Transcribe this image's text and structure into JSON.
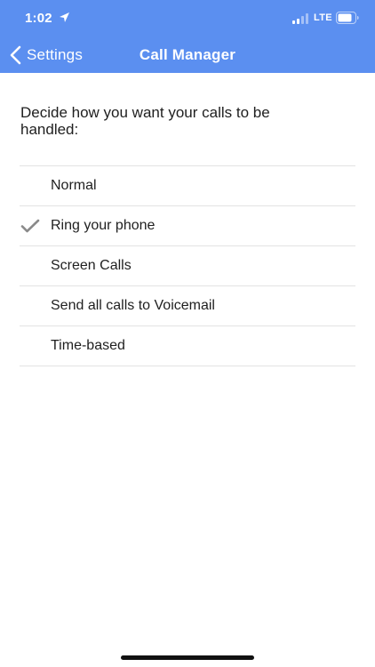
{
  "status_bar": {
    "time": "1:02",
    "network": "LTE",
    "location_icon": "location-arrow-icon",
    "signal_icon": "cellular-signal-icon",
    "battery_icon": "battery-icon"
  },
  "nav": {
    "back_label": "Settings",
    "back_icon": "chevron-left-icon",
    "title": "Call Manager"
  },
  "prompt": "Decide how you want your calls to be handled:",
  "options": [
    {
      "label": "Normal",
      "selected": false
    },
    {
      "label": "Ring your phone",
      "selected": true
    },
    {
      "label": "Screen Calls",
      "selected": false
    },
    {
      "label": "Send all calls to Voicemail",
      "selected": false
    },
    {
      "label": "Time-based",
      "selected": false
    }
  ],
  "colors": {
    "header": "#5b8ff0",
    "check": "#8a8a8a",
    "divider": "#e3e3e3"
  }
}
